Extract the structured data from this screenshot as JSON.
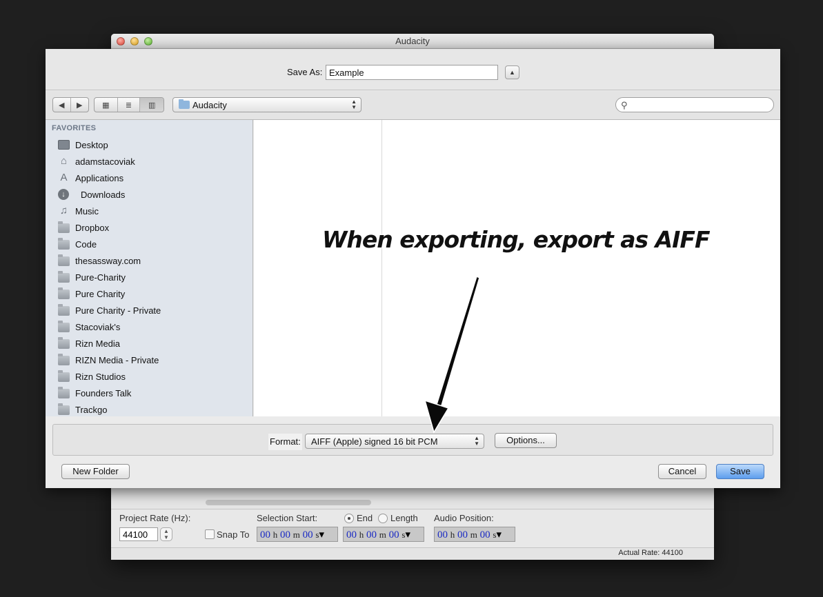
{
  "app": {
    "title": "Audacity",
    "project_rate_label": "Project Rate (Hz):",
    "project_rate_value": "44100",
    "snap_to_label": "Snap To",
    "selection_start_label": "Selection Start:",
    "end_label": "End",
    "length_label": "Length",
    "audio_position_label": "Audio Position:",
    "time_digits": "00",
    "unit_h": "h",
    "unit_m": "m",
    "unit_s": "s",
    "status_text": "Actual Rate: 44100"
  },
  "sheet": {
    "save_as_label": "Save As:",
    "save_as_value": "Example",
    "location": "Audacity",
    "search_placeholder": "",
    "favorites_header": "FAVORITES",
    "favorites": [
      {
        "label": "Desktop",
        "icon": "desktop-icon"
      },
      {
        "label": "adamstacoviak",
        "icon": "home-icon"
      },
      {
        "label": "Applications",
        "icon": "applications-icon"
      },
      {
        "label": "Downloads",
        "icon": "downloads-icon"
      },
      {
        "label": "Music",
        "icon": "music-icon"
      },
      {
        "label": "Dropbox",
        "icon": "folder-icon"
      },
      {
        "label": "Code",
        "icon": "folder-icon"
      },
      {
        "label": "thesassway.com",
        "icon": "folder-icon"
      },
      {
        "label": "Pure-Charity",
        "icon": "folder-icon"
      },
      {
        "label": "Pure Charity",
        "icon": "folder-icon"
      },
      {
        "label": "Pure Charity - Private",
        "icon": "folder-icon"
      },
      {
        "label": "Stacoviak's",
        "icon": "folder-icon"
      },
      {
        "label": "Rizn Media",
        "icon": "folder-icon"
      },
      {
        "label": "RIZN Media - Private",
        "icon": "folder-icon"
      },
      {
        "label": "Rizn Studios",
        "icon": "folder-icon"
      },
      {
        "label": "Founders Talk",
        "icon": "folder-icon"
      },
      {
        "label": "Trackgo",
        "icon": "folder-icon"
      }
    ],
    "format_label": "Format:",
    "format_value": "AIFF (Apple) signed 16 bit PCM",
    "options_button": "Options...",
    "new_folder_button": "New Folder",
    "cancel_button": "Cancel",
    "save_button": "Save"
  },
  "annotation": {
    "text": "When exporting, export as AIFF"
  }
}
